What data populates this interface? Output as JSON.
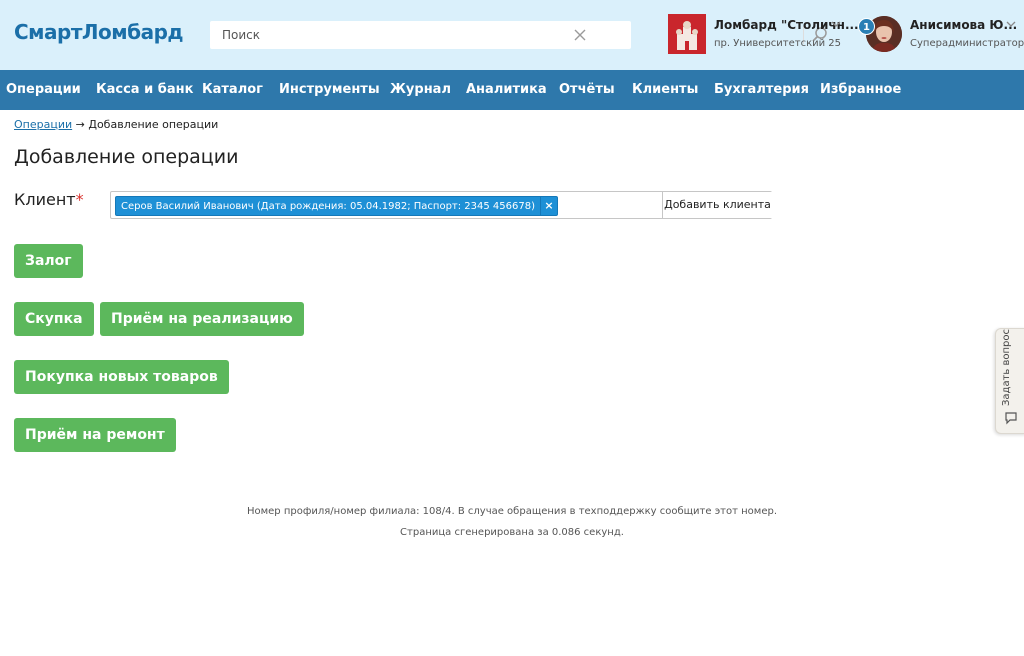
{
  "header": {
    "logo": "СмартЛомбард",
    "search": {
      "placeholder": "Поиск",
      "value": ""
    },
    "branch": {
      "name": "Ломбард \"Столичн...",
      "address": "пр. Университетский 25"
    },
    "user": {
      "name": "Анисимова Ю...",
      "role": "Суперадминистратор",
      "notifications": "1"
    }
  },
  "nav": {
    "items": [
      "Операции",
      "Касса и банк",
      "Каталог",
      "Инструменты",
      "Журнал",
      "Аналитика",
      "Отчёты",
      "Клиенты",
      "Бухгалтерия",
      "Избранное"
    ]
  },
  "breadcrumb": {
    "link": "Операции",
    "separator": " → ",
    "current": "Добавление операции"
  },
  "page": {
    "title": "Добавление операции",
    "client_label": "Клиент",
    "client_required_mark": "*",
    "client_value": "Серов Василий Иванович (Дата рождения: 05.04.1982; Паспорт: 2345 456678)",
    "client_remove": "×",
    "add_client_label": "Добавить клиента"
  },
  "operations": {
    "pledge": "Залог",
    "buyout": "Скупка",
    "consignment": "Приём на реализацию",
    "new_goods": "Покупка новых товаров",
    "repair": "Приём на ремонт"
  },
  "footer": {
    "line1": "Номер профиля/номер филиала: 108/4. В случае обращения в техподдержку сообщите этот номер.",
    "line2": "Страница сгенерирована за 0.086 секунд."
  },
  "widget": {
    "ask_label": "Задать вопрос"
  },
  "colors": {
    "header_bg": "#daf0fb",
    "nav_bg": "#2e78ab",
    "button_green": "#5cb85c",
    "tag_blue": "#1e90d6",
    "logo_blue": "#1b6fa8"
  },
  "icons": {
    "search": "magnifier-icon",
    "clear": "close-icon",
    "chevron": "chevron-down-icon",
    "ask": "chat-bubble-icon"
  }
}
